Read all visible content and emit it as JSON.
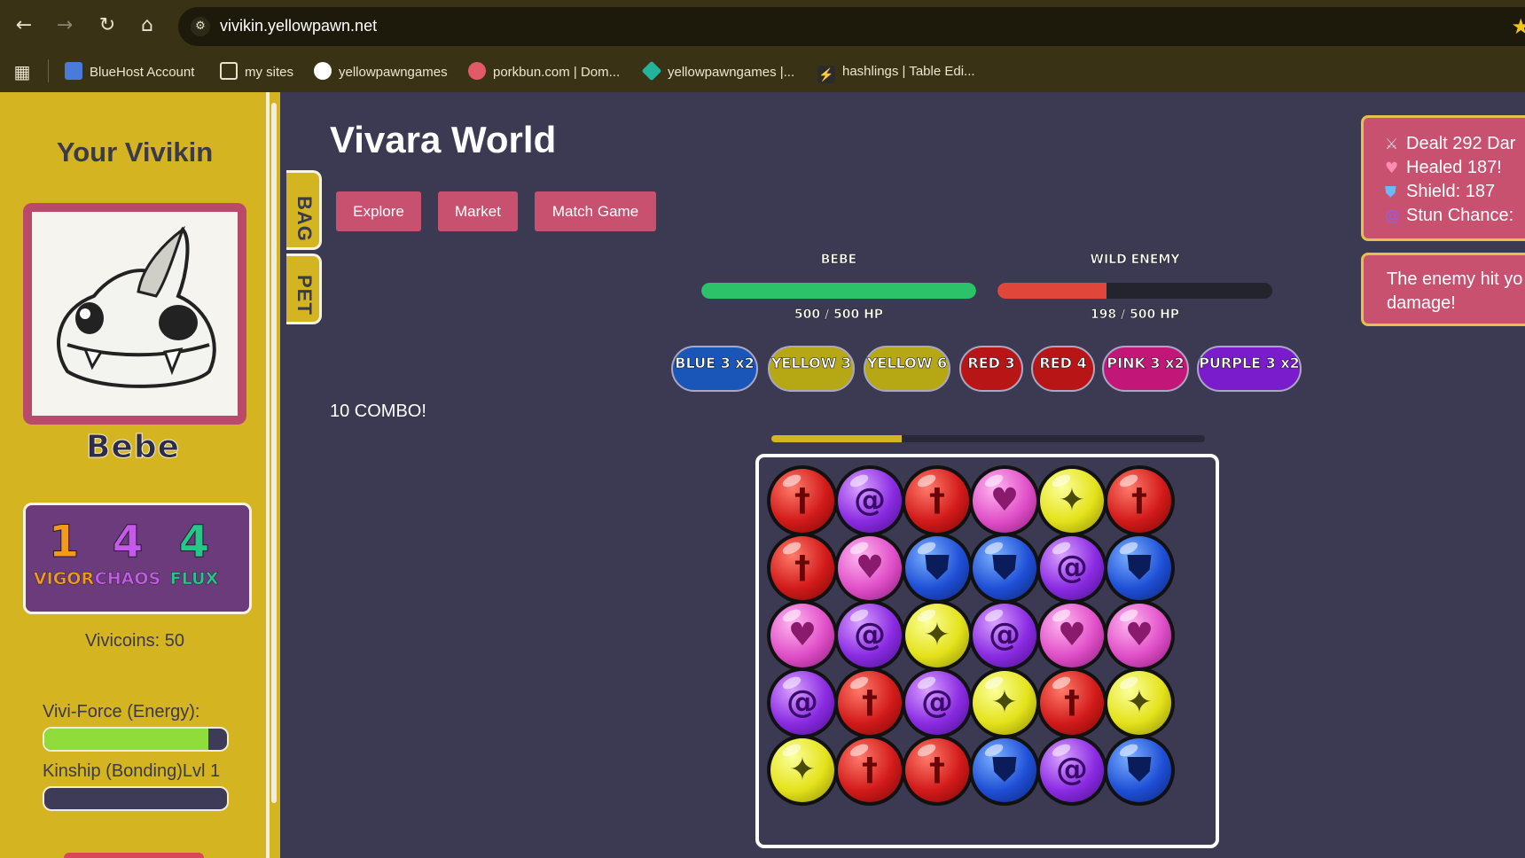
{
  "browser": {
    "url": "vivikin.yellowpawn.net",
    "bookmarks": [
      {
        "label": "BlueHost Account",
        "color": "#4a7bd8"
      },
      {
        "label": "my sites",
        "color": "#e8e2cf"
      },
      {
        "label": "yellowpawngames",
        "color": "#ffffff"
      },
      {
        "label": "porkbun.com | Dom...",
        "color": "#e05a6a"
      },
      {
        "label": "yellowpawngames |...",
        "color": "#22b59b"
      },
      {
        "label": "hashlings | Table Edi...",
        "color": "#2b2b2b"
      }
    ]
  },
  "sidebar": {
    "title": "Your Vivikin",
    "pet_name": "Bebe",
    "stats": [
      {
        "value": "1",
        "label": "VIGOR",
        "color": "#f39a1c"
      },
      {
        "value": "4",
        "label": "CHAOS",
        "color": "#c45ae8"
      },
      {
        "value": "4",
        "label": "FLUX",
        "color": "#24c98a"
      }
    ],
    "coins": "Vivicoins: 50",
    "energy_label": "Vivi-Force (Energy):",
    "energy_level": 0.9,
    "kinship_label": "Kinship (Bonding)Lvl 1",
    "kinship_level": 0.0
  },
  "tabs": {
    "bag": "BAG",
    "pet": "PET"
  },
  "main": {
    "title": "Vivara World",
    "nav": [
      "Explore",
      "Market",
      "Match Game"
    ],
    "player": {
      "name": "BEBE",
      "hp_text": "500 / 500 HP",
      "hp_fraction": 1.0,
      "color": "#2cc26a"
    },
    "enemy": {
      "name": "WILD ENEMY",
      "hp_text": "198 / 500 HP",
      "hp_fraction": 0.396,
      "color": "#e0463a"
    },
    "matches": [
      {
        "label": "BLUE 3 x2",
        "color": "#1a56b8"
      },
      {
        "label": "YELLOW 3",
        "color": "#b5a814"
      },
      {
        "label": "YELLOW 6",
        "color": "#b5a814"
      },
      {
        "label": "RED 3",
        "color": "#b81616"
      },
      {
        "label": "RED 4",
        "color": "#b81616"
      },
      {
        "label": "PINK 3 x2",
        "color": "#c21778"
      },
      {
        "label": "PURPLE 3 x2",
        "color": "#7a1ccc"
      }
    ],
    "combo": "10 COMBO!",
    "timer_fraction": 0.3,
    "board": [
      [
        "red",
        "purple",
        "red",
        "pink",
        "yellow",
        "red"
      ],
      [
        "red",
        "pink",
        "blue",
        "blue",
        "purple",
        "blue"
      ],
      [
        "pink",
        "purple",
        "yellow",
        "purple",
        "pink",
        "pink"
      ],
      [
        "purple",
        "red",
        "purple",
        "yellow",
        "red",
        "yellow"
      ],
      [
        "yellow",
        "red",
        "red",
        "blue",
        "purple",
        "blue"
      ]
    ]
  },
  "toasts": {
    "battle": [
      {
        "icon": "swords-icon",
        "emoji": "⚔",
        "text": "Dealt 292 Dar"
      },
      {
        "icon": "heart-icon",
        "emoji": "♥",
        "text": "Healed 187!"
      },
      {
        "icon": "shield-icon",
        "emoji": "⛊",
        "text": "Shield: 187"
      },
      {
        "icon": "spiral-icon",
        "emoji": "@",
        "text": "Stun Chance:"
      }
    ],
    "enemy_line1": "The enemy hit yo",
    "enemy_line2": "damage!"
  }
}
